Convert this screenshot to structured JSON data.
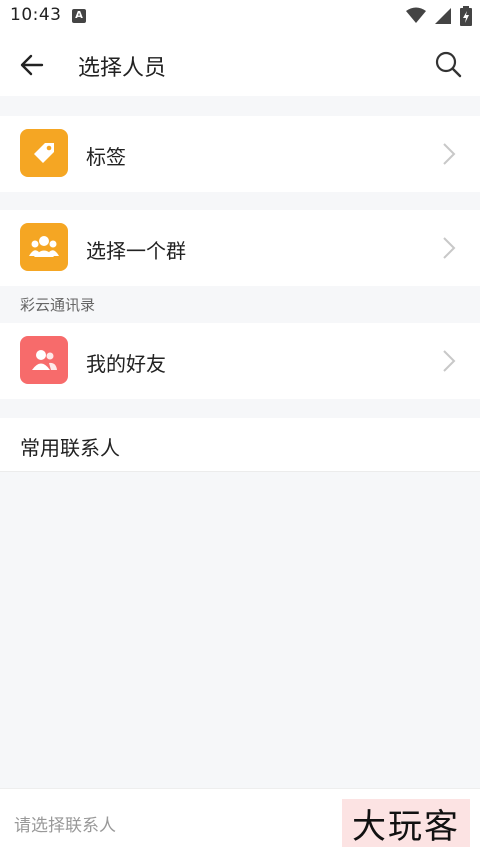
{
  "status": {
    "time": "10:43",
    "notif_icon": "A"
  },
  "header": {
    "title": "选择人员"
  },
  "rows": [
    {
      "label": "标签",
      "icon": "tag-icon",
      "color": "#f5a623"
    },
    {
      "label": "选择一个群",
      "icon": "group-icon",
      "color": "#f5a623"
    },
    {
      "label": "我的好友",
      "icon": "friends-icon",
      "color": "#f76b6b"
    }
  ],
  "section": {
    "label": "彩云通讯录"
  },
  "frequent": {
    "label": "常用联系人"
  },
  "bottom": {
    "placeholder": "请选择联系人",
    "watermark": "大玩客"
  }
}
